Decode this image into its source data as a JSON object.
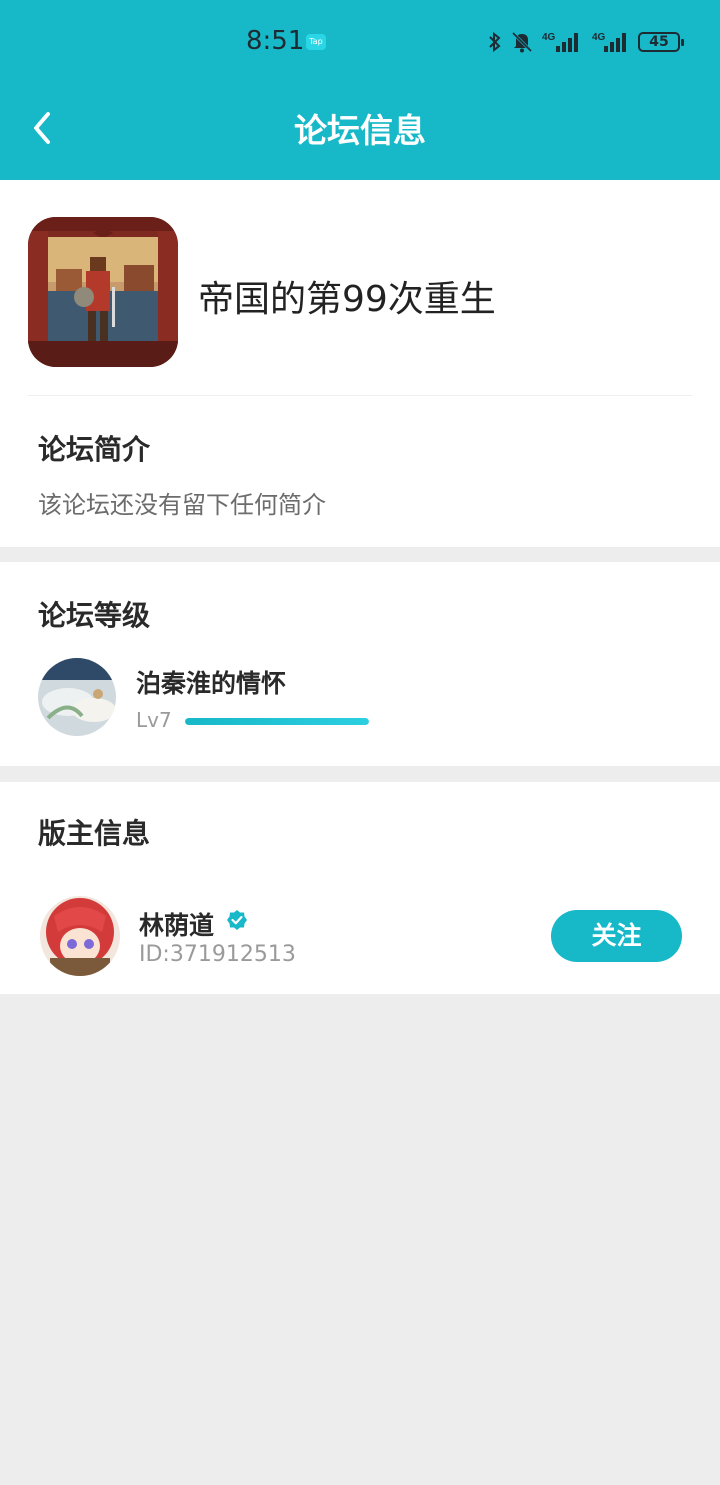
{
  "status_bar": {
    "time": "8:51",
    "tap_label": "Tap",
    "signal_label_1": "4G",
    "signal_label_2": "4G",
    "battery": "45"
  },
  "header": {
    "title": "论坛信息",
    "color": "#17b8c8"
  },
  "forum": {
    "name": "帝国的第99次重生",
    "intro_title": "论坛简介",
    "intro_text": "该论坛还没有留下任何简介"
  },
  "level": {
    "section_title": "论坛等级",
    "name": "泊秦淮的情怀",
    "lv": "Lv7",
    "progress": 1.0
  },
  "moderator": {
    "section_title": "版主信息",
    "name": "林荫道",
    "id": "ID:371912513",
    "follow_label": "关注"
  },
  "icons": [
    "back-icon",
    "bluetooth-icon",
    "mute-icon",
    "signal-icon",
    "battery-icon",
    "verified-icon"
  ]
}
